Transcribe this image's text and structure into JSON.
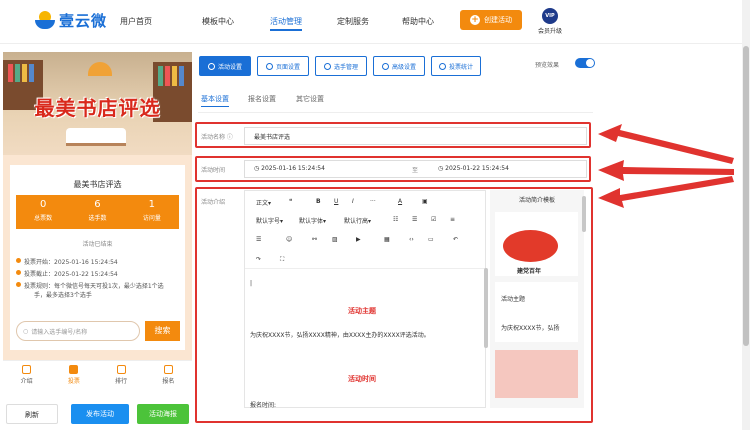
{
  "header": {
    "logo_text": "壹云微",
    "nav": [
      "用户首页",
      "模板中心",
      "活动管理",
      "定制服务",
      "帮助中心"
    ],
    "create_btn": "创建活动",
    "vip_badge": "VIP",
    "vip_label": "会员升级"
  },
  "phone": {
    "banner_title": "最美书店评选",
    "card_title": "最美书店评选",
    "stats": [
      {
        "num": "0",
        "label": "总票数"
      },
      {
        "num": "6",
        "label": "选手数"
      },
      {
        "num": "1",
        "label": "访问量"
      }
    ],
    "ended": "活动已结束",
    "vote_start": "投票开始：2025-01-16 15:24:54",
    "vote_end": "投票截止：2025-01-22 15:24:54",
    "rule_line1": "投票规则：每个微信号每天可投1次，最少选择1个选",
    "rule_line2": "手，最多选择3个选手",
    "search_placeholder": "请输入选手编号/名称",
    "search_btn": "搜索",
    "tabs": [
      "介绍",
      "投票",
      "排行",
      "报名"
    ]
  },
  "bottom": {
    "refresh": "刷新",
    "publish": "发布活动",
    "poster": "活动海报"
  },
  "toolbar": {
    "btns": [
      "活动设置",
      "页面设置",
      "选手管理",
      "高级设置",
      "投票统计"
    ],
    "preview": "预览效果"
  },
  "subtabs": [
    "基本设置",
    "报名设置",
    "其它设置"
  ],
  "form": {
    "name_label": "活动名称",
    "name_value": "最美书店评选",
    "time_label": "活动时间",
    "start": "2025-01-16 15:24:54",
    "to": "至",
    "end": "2025-01-22 15:24:54",
    "intro_label": "活动介绍"
  },
  "editor": {
    "row1": [
      "正文",
      "❝",
      "B",
      "U",
      "I",
      "···",
      "A",
      "▣"
    ],
    "row2": [
      "默认字号",
      "默认字体",
      "默认行高",
      "☷",
      "☰",
      "☑",
      "≡"
    ],
    "row3": [
      "☰",
      "☺",
      "⚯",
      "▨",
      "▶",
      "▦",
      "‹›",
      "▭",
      "↶"
    ],
    "row4": [
      "↷",
      "⛶"
    ],
    "heading1": "活动主题",
    "body1": "为庆祝XXXX节，弘扬XXXX精神，由XXXX主办的XXXX评选活动。",
    "heading2": "活动时间",
    "body2": "报名时间:"
  },
  "templates": {
    "title": "活动简介模板",
    "card_title": "活动主题",
    "card_sub": "为庆祝XXXX节，弘扬",
    "img_text": "建党百年"
  }
}
